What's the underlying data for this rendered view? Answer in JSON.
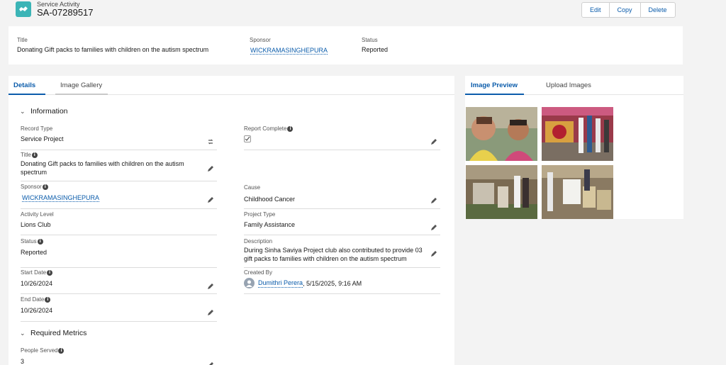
{
  "header": {
    "object_label": "Service Activity",
    "record_name": "SA-07289517",
    "icon": "handshake-icon",
    "actions": [
      "Edit",
      "Copy",
      "Delete"
    ]
  },
  "highlights": {
    "title_label": "Title",
    "title_value": "Donating Gift packs to families with children on the autism spectrum",
    "sponsor_label": "Sponsor",
    "sponsor_value": "WICKRAMASINGHEPURA",
    "status_label": "Status",
    "status_value": "Reported"
  },
  "tabs": [
    "Details",
    "Image Gallery"
  ],
  "sections": {
    "information": "Information",
    "required_metrics": "Required Metrics"
  },
  "fields": {
    "record_type": {
      "label": "Record Type",
      "value": "Service Project"
    },
    "report_complete": {
      "label": "Report Complete",
      "value": true
    },
    "title": {
      "label": "Title",
      "value": "Donating Gift packs to families with children on the autism spectrum"
    },
    "sponsor": {
      "label": "Sponsor",
      "value": "WICKRAMASINGHEPURA"
    },
    "cause": {
      "label": "Cause",
      "value": "Childhood Cancer"
    },
    "activity_level": {
      "label": "Activity Level",
      "value": "Lions Club"
    },
    "project_type": {
      "label": "Project Type",
      "value": "Family Assistance"
    },
    "status": {
      "label": "Status",
      "value": "Reported"
    },
    "description": {
      "label": "Description",
      "value": "During Sinha Saviya Project club also contributed to provide 03 gift packs to families with children on the autism spectrum"
    },
    "start_date": {
      "label": "Start Date",
      "value": "10/26/2024"
    },
    "created_by": {
      "label": "Created By",
      "user": "Dumithri Perera",
      "date": ", 5/15/2025, 9:16 AM"
    },
    "end_date": {
      "label": "End Date",
      "value": "10/26/2024"
    },
    "people_served": {
      "label": "People Served",
      "value": "3"
    }
  },
  "image_panel": {
    "tabs": [
      "Image Preview",
      "Upload Images"
    ]
  },
  "colors": {
    "accent": "#0b5cab",
    "record_icon": "#3bb4b6",
    "page_bg": "#f3f3f3"
  }
}
